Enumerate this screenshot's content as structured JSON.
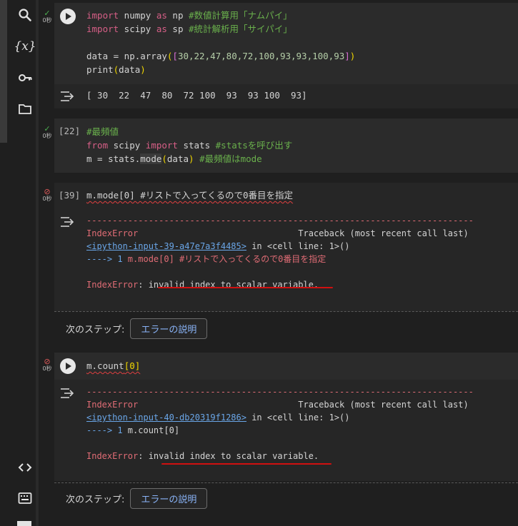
{
  "sidebar": {
    "icons": [
      "search-icon",
      "variables-icon",
      "key-icon",
      "folder-icon",
      "code-snippets-icon",
      "terminal-icon"
    ],
    "variables_label": "{x}"
  },
  "cells": {
    "c1": {
      "status_secs": "0秒",
      "lines": [
        [
          "import",
          " numpy ",
          "as",
          " np ",
          "#数値計算用「ナムパイ」"
        ],
        [
          "import",
          " scipy ",
          "as",
          " sp ",
          "#統計解析用「サイパイ」"
        ],
        [],
        [
          "data = np.array",
          "(",
          "[",
          "30,22,47,80,72,100,93,93,100,93",
          "]",
          ")"
        ],
        [
          "print",
          "(",
          "data",
          ")"
        ]
      ],
      "output": "[ 30  22  47  80  72 100  93  93 100  93]"
    },
    "c2": {
      "status_secs": "0秒",
      "exec_count": "[22]",
      "line1": "#最頻値",
      "line2_from": "from",
      "line2_mid": " scipy ",
      "line2_import": "import",
      "line2_stats": " stats ",
      "line2_comment": "#statsを呼び出す",
      "line3_code": "m = stats.",
      "line3_mode": "mode",
      "line3_paren_open": "(",
      "line3_arg": "data",
      "line3_paren_close": ")",
      "line3_comment": " #最頻値はmode"
    },
    "c3": {
      "status_secs": "0秒",
      "exec_count": "[39]",
      "code": "m.mode[0] #リストで入ってくるので0番目を指定",
      "dashes": "---------------------------------------------------------------------------",
      "err_name": "IndexError",
      "traceback": "Traceback (most recent call last)",
      "link": "<ipython-input-39-a47e7a3f4485>",
      "in_cell": " in <cell line: 1>()",
      "arrow_line_prefix": "----> 1 ",
      "arrow_line_code": "m.mode[0] #リストで入ってくるので0番目を指定",
      "err_msg": ": invalid index to scalar variable.",
      "next_step_label": "次のステップ:",
      "explain_button": "エラーの説明"
    },
    "c4": {
      "status_secs": "0秒",
      "code_prefix": "m.count",
      "code_bracket": "[0]",
      "dashes": "---------------------------------------------------------------------------",
      "err_name": "IndexError",
      "traceback": "Traceback (most recent call last)",
      "link": "<ipython-input-40-db20319f1286>",
      "in_cell": " in <cell line: 1>()",
      "arrow_line_prefix": "----> 1 ",
      "arrow_line_code": "m.count[0]",
      "err_msg": ": invalid index to scalar variable.",
      "next_step_label": "次のステップ:",
      "explain_button": "エラーの説明"
    }
  },
  "colors": {
    "annotation_underline": "#d01010",
    "error_red": "#e06c75",
    "link_blue": "#6aa6e8",
    "success_green": "#4caf50"
  }
}
